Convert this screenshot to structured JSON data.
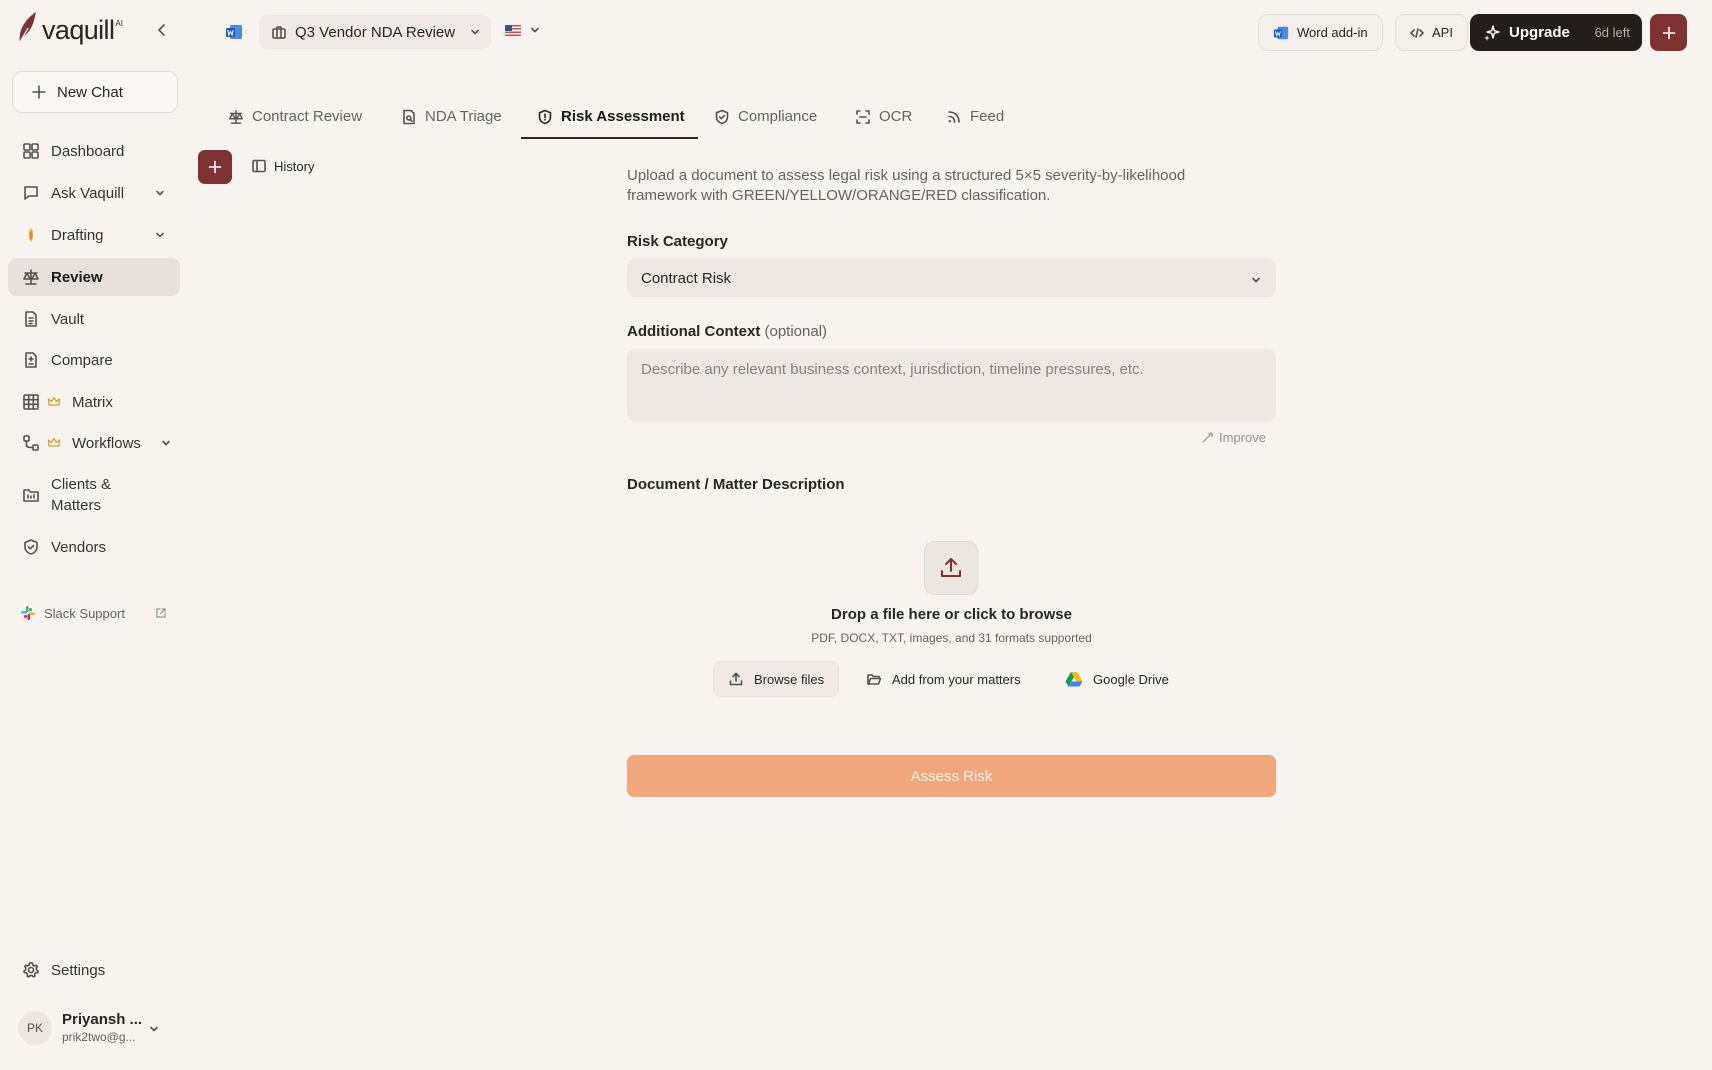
{
  "app": {
    "logo_text": "vaquill",
    "logo_badge": "AI"
  },
  "sidebar": {
    "new_chat": "New Chat",
    "items": [
      {
        "label": "Dashboard"
      },
      {
        "label": "Ask Vaquill"
      },
      {
        "label": "Drafting"
      },
      {
        "label": "Review"
      },
      {
        "label": "Vault"
      },
      {
        "label": "Compare"
      },
      {
        "label": "Matrix"
      },
      {
        "label": "Workflows"
      },
      {
        "label": "Clients & Matters"
      },
      {
        "label": "Vendors"
      }
    ],
    "active": "Review",
    "slack": "Slack Support",
    "settings": "Settings",
    "user": {
      "initials": "PK",
      "name": "Priyansh ...",
      "email": "prik2two@g..."
    }
  },
  "topbar": {
    "document": "Q3 Vendor NDA Review",
    "word_addin": "Word add-in",
    "api": "API",
    "upgrade": "Upgrade",
    "trial_left": "6d left"
  },
  "tabs": [
    {
      "label": "Contract Review"
    },
    {
      "label": "NDA Triage"
    },
    {
      "label": "Risk Assessment"
    },
    {
      "label": "Compliance"
    },
    {
      "label": "OCR"
    },
    {
      "label": "Feed"
    }
  ],
  "active_tab": "Risk Assessment",
  "history_label": "History",
  "form": {
    "intro": "Upload a document to assess legal risk using a structured 5×5 severity-by-likelihood framework with GREEN/YELLOW/ORANGE/RED classification.",
    "risk_category_label": "Risk Category",
    "risk_category_value": "Contract Risk",
    "context_label": "Additional Context",
    "context_optional": "(optional)",
    "context_placeholder": "Describe any relevant business context, jurisdiction, timeline pressures, etc.",
    "improve": "Improve",
    "document_label": "Document / Matter Description",
    "drop_title": "Drop a file here or click to browse",
    "drop_sub": "PDF, DOCX, TXT, images, and 31 formats supported",
    "browse": "Browse files",
    "from_matters": "Add from your matters",
    "google_drive": "Google Drive",
    "submit": "Assess Risk"
  },
  "colors": {
    "brand_maroon": "#7e3332",
    "accent_orange": "#f0a77c",
    "background": "#f7f3ef",
    "upgrade_dark": "#231e1c"
  }
}
